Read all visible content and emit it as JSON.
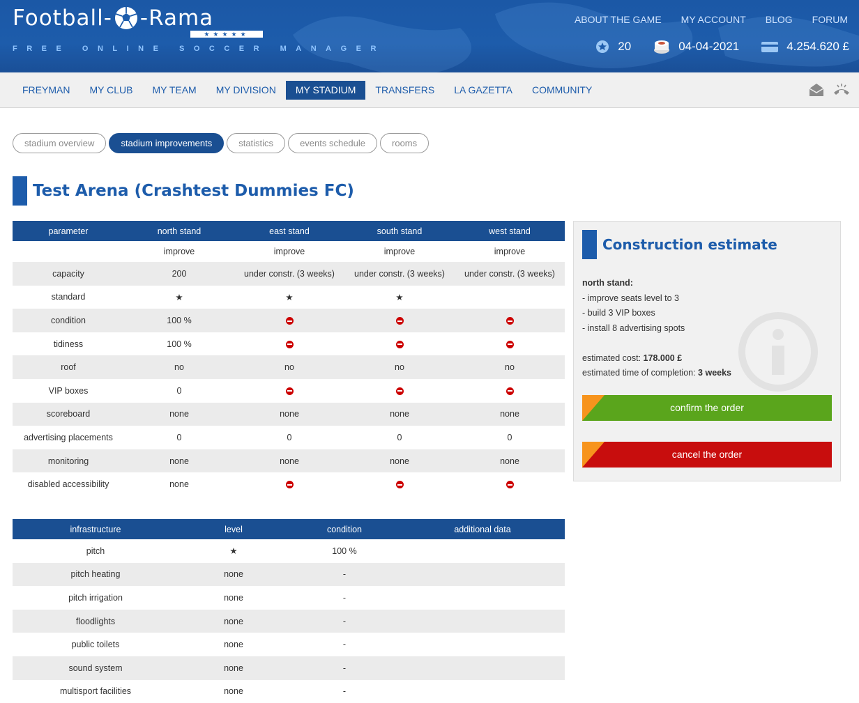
{
  "header": {
    "logo_left": "Football-",
    "logo_right": "-Rama",
    "logo_stars": "★★★★★",
    "tagline": "FREE ONLINE SOCCER MANAGER",
    "topnav": [
      "ABOUT THE GAME",
      "MY ACCOUNT",
      "BLOG",
      "FORUM"
    ],
    "stats": {
      "level": "20",
      "date": "04-04-2021",
      "money": "4.254.620 £"
    }
  },
  "mainnav": {
    "items": [
      "FREYMAN",
      "MY CLUB",
      "MY TEAM",
      "MY DIVISION",
      "MY STADIUM",
      "TRANSFERS",
      "LA GAZETTA",
      "COMMUNITY"
    ],
    "active": "MY STADIUM"
  },
  "subtabs": {
    "items": [
      "stadium overview",
      "stadium improvements",
      "statistics",
      "events schedule",
      "rooms"
    ],
    "active": "stadium improvements"
  },
  "page_title": "Test Arena (Crashtest Dummies FC)",
  "stands_table": {
    "headers": [
      "parameter",
      "north stand",
      "east stand",
      "south stand",
      "west stand"
    ],
    "improve_label": "improve",
    "rows": [
      {
        "param": "capacity",
        "north": "200",
        "east": "under constr. (3 weeks)",
        "south": "under constr. (3 weeks)",
        "west": "under constr. (3 weeks)"
      },
      {
        "param": "standard",
        "north": "★",
        "east": "★",
        "south": "★",
        "west": ""
      },
      {
        "param": "condition",
        "north": "100 %",
        "east": "no-entry",
        "south": "no-entry",
        "west": "no-entry"
      },
      {
        "param": "tidiness",
        "north": "100 %",
        "east": "no-entry",
        "south": "no-entry",
        "west": "no-entry"
      },
      {
        "param": "roof",
        "north": "no",
        "east": "no",
        "south": "no",
        "west": "no"
      },
      {
        "param": "VIP boxes",
        "north": "0",
        "east": "no-entry",
        "south": "no-entry",
        "west": "no-entry"
      },
      {
        "param": "scoreboard",
        "north": "none",
        "east": "none",
        "south": "none",
        "west": "none"
      },
      {
        "param": "advertising placements",
        "north": "0",
        "east": "0",
        "south": "0",
        "west": "0"
      },
      {
        "param": "monitoring",
        "north": "none",
        "east": "none",
        "south": "none",
        "west": "none"
      },
      {
        "param": "disabled accessibility",
        "north": "none",
        "east": "no-entry",
        "south": "no-entry",
        "west": "no-entry"
      }
    ]
  },
  "infra_table": {
    "headers": [
      "infrastructure",
      "level",
      "condition",
      "additional data"
    ],
    "rows": [
      {
        "name": "pitch",
        "level": "★",
        "condition": "100 %",
        "extra": ""
      },
      {
        "name": "pitch heating",
        "level": "none",
        "condition": "-",
        "extra": ""
      },
      {
        "name": "pitch irrigation",
        "level": "none",
        "condition": "-",
        "extra": ""
      },
      {
        "name": "floodlights",
        "level": "none",
        "condition": "-",
        "extra": ""
      },
      {
        "name": "public toilets",
        "level": "none",
        "condition": "-",
        "extra": ""
      },
      {
        "name": "sound system",
        "level": "none",
        "condition": "-",
        "extra": ""
      },
      {
        "name": "multisport facilities",
        "level": "none",
        "condition": "-",
        "extra": ""
      }
    ]
  },
  "estimate": {
    "title": "Construction estimate",
    "stand": "north stand:",
    "items": [
      "- improve seats level to 3",
      "- build 3 VIP boxes",
      "- install 8 advertising spots"
    ],
    "cost_label": "estimated cost: ",
    "cost_value": "178.000 £",
    "time_label": "estimated time of completion: ",
    "time_value": "3 weeks",
    "confirm_label": "confirm the order",
    "cancel_label": "cancel the order"
  },
  "colors": {
    "brand_blue": "#1d5cab",
    "nav_active": "#1a4f92",
    "confirm_green": "#5aa51c",
    "cancel_red": "#c80d0d",
    "accent_orange": "#f7941d"
  }
}
